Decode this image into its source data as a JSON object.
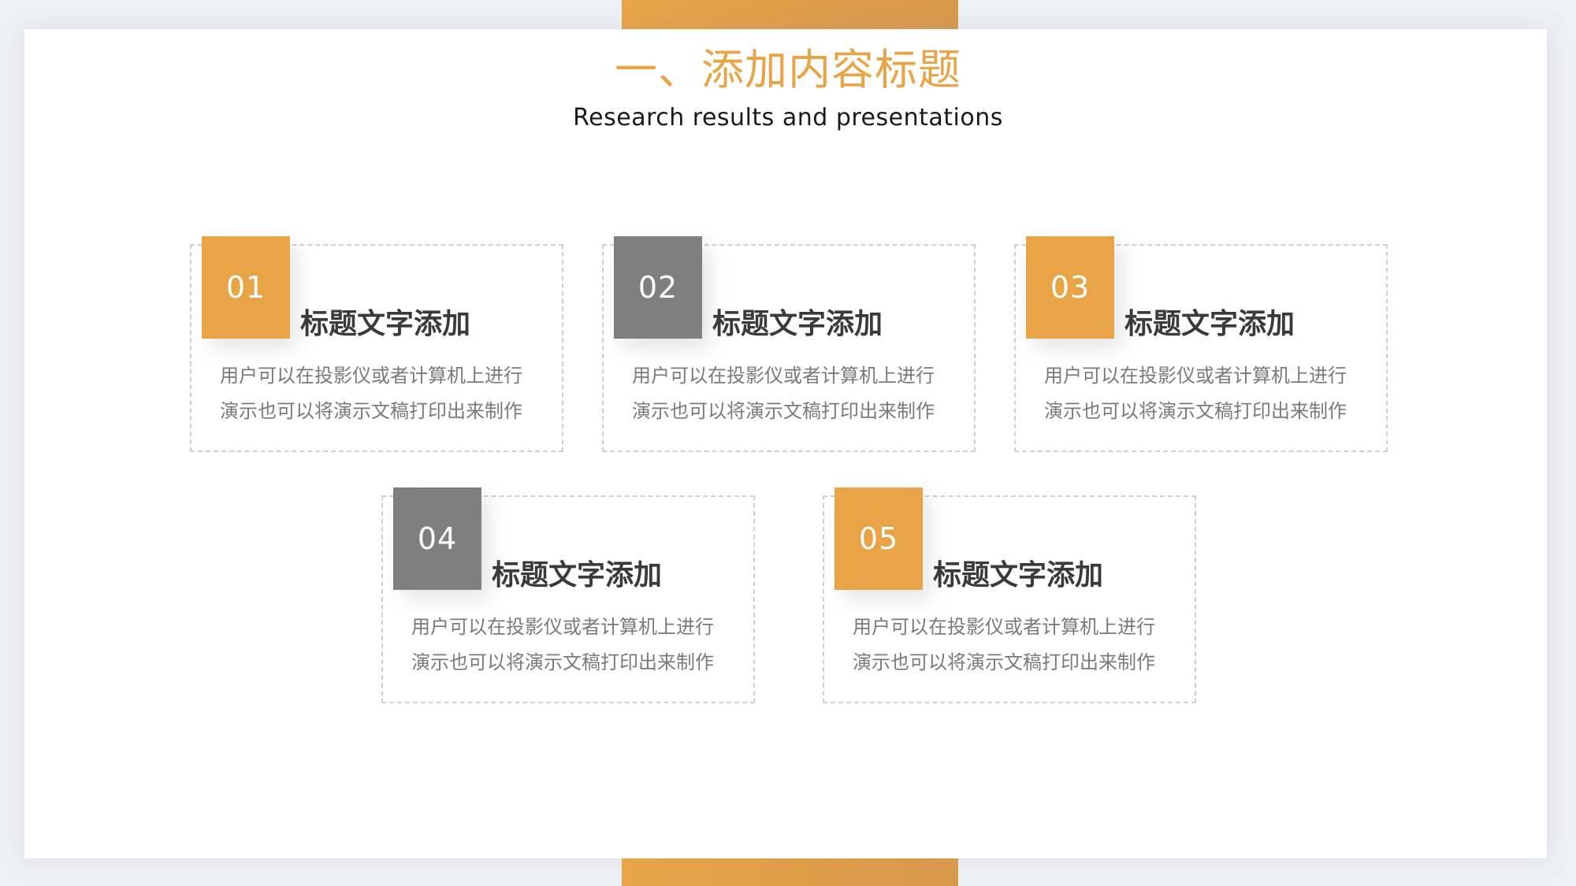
{
  "header": {
    "title": "一、添加内容标题",
    "subtitle": "Research results and presentations"
  },
  "colors": {
    "accent_orange": "#e8a447",
    "accent_gray": "#7f7f7f",
    "title_text": "#3a3a3a",
    "body_text": "#7a7a7a"
  },
  "cards": [
    {
      "number": "01",
      "title": "标题文字添加",
      "line1": "用户可以在投影仪或者计算机上进行",
      "line2": "演示也可以将演示文稿打印出来制作",
      "badge_color": "#e8a447"
    },
    {
      "number": "02",
      "title": "标题文字添加",
      "line1": "用户可以在投影仪或者计算机上进行",
      "line2": "演示也可以将演示文稿打印出来制作",
      "badge_color": "#7f7f7f"
    },
    {
      "number": "03",
      "title": "标题文字添加",
      "line1": "用户可以在投影仪或者计算机上进行",
      "line2": "演示也可以将演示文稿打印出来制作",
      "badge_color": "#e8a447"
    },
    {
      "number": "04",
      "title": "标题文字添加",
      "line1": "用户可以在投影仪或者计算机上进行",
      "line2": "演示也可以将演示文稿打印出来制作",
      "badge_color": "#7f7f7f"
    },
    {
      "number": "05",
      "title": "标题文字添加",
      "line1": "用户可以在投影仪或者计算机上进行",
      "line2": "演示也可以将演示文稿打印出来制作",
      "badge_color": "#e8a447"
    }
  ]
}
